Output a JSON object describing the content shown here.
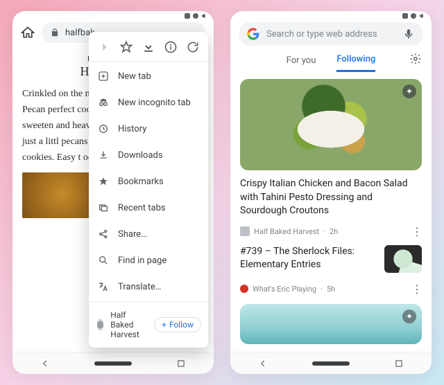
{
  "left": {
    "urlbar": {
      "host": "halfbak"
    },
    "brand_line1": "H A L F",
    "brand_line2": "H A R",
    "article_text": "Crinkled on the middle, and oh Bourbon Pecan perfect cookies browned butte lightly sweeten and heavy on t crisp on the ed with just a littl pecans…so DE to love about t cookies. Easy t occasions…esp",
    "menu": {
      "new_tab": "New tab",
      "new_incognito": "New incognito tab",
      "history": "History",
      "downloads": "Downloads",
      "bookmarks": "Bookmarks",
      "recent_tabs": "Recent tabs",
      "share": "Share…",
      "find_in_page": "Find in page",
      "translate": "Translate…",
      "site_name": "Half Baked Harvest",
      "follow_label": "Follow"
    }
  },
  "right": {
    "search_placeholder": "Search or type web address",
    "tabs": {
      "for_you": "For you",
      "following": "Following"
    },
    "card1": {
      "title": "Crispy Italian Chicken and Bacon Salad with Tahini Pesto Dressing and Sourdough Croutons",
      "source": "Half Baked Harvest",
      "age": "2h"
    },
    "card2": {
      "title": "#739 – The Sherlock Files: Elementary Entries",
      "source": "What's Eric Playing",
      "age": "5h"
    }
  }
}
